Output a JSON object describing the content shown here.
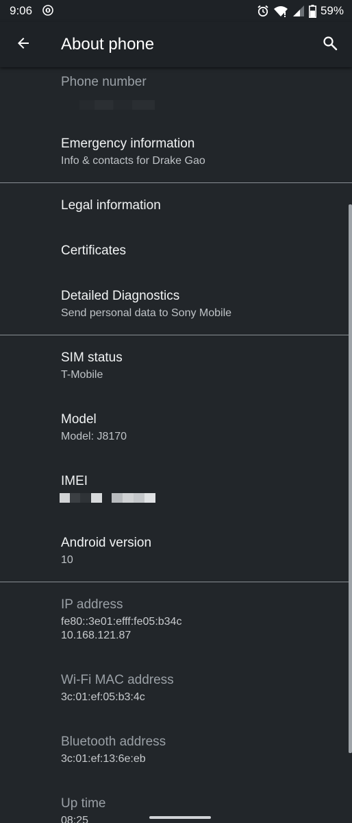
{
  "status_bar": {
    "time": "9:06",
    "battery": "59%",
    "icons": [
      "app-notification-icon",
      "alarm-icon",
      "wifi-icon",
      "signal-icon",
      "battery-icon"
    ]
  },
  "app_bar": {
    "title": "About phone",
    "back_icon": "arrow-back-icon",
    "search_icon": "search-icon"
  },
  "items": {
    "phone_number": {
      "title": "Phone number"
    },
    "emergency": {
      "title": "Emergency information",
      "subtitle": "Info & contacts for Drake Gao"
    },
    "legal": {
      "title": "Legal information"
    },
    "certificates": {
      "title": "Certificates"
    },
    "diagnostics": {
      "title": "Detailed Diagnostics",
      "subtitle": "Send personal data to Sony Mobile"
    },
    "sim": {
      "title": "SIM status",
      "subtitle": "T-Mobile"
    },
    "model": {
      "title": "Model",
      "subtitle": "Model: J8170"
    },
    "imei": {
      "title": "IMEI"
    },
    "android": {
      "title": "Android version",
      "subtitle": "10"
    },
    "ip": {
      "title": "IP address",
      "line1": "fe80::3e01:efff:fe05:b34c",
      "line2": "10.168.121.87"
    },
    "wifi_mac": {
      "title": "Wi-Fi MAC address",
      "subtitle": "3c:01:ef:05:b3:4c"
    },
    "bluetooth": {
      "title": "Bluetooth address",
      "subtitle": "3c:01:ef:13:6e:eb"
    },
    "uptime": {
      "title": "Up time",
      "subtitle": "08:25"
    }
  },
  "colors": {
    "background": "#22262a",
    "app_bar": "#1e2226",
    "divider": "#8a8f94"
  }
}
